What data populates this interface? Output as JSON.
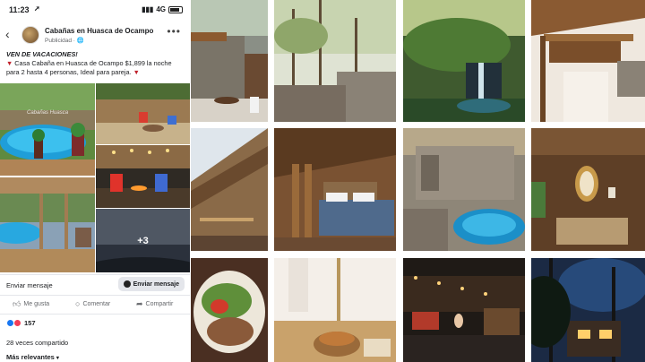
{
  "status_bar": {
    "time": "11:23",
    "network": "4G"
  },
  "post": {
    "page_name": "Cabañas en Huasca de Ocampo",
    "sponsored": "Publicidad · 🌐",
    "headline": "VEN DE VACACIONES!",
    "body_before": "Casa Cabaña en Huasca de Ocampo $1,899 la noche para 2 hasta 4 personas, Ideal para pareja.",
    "photo_overflow": "+3",
    "watermark": "Cabañas Huasca"
  },
  "message": {
    "label": "Enviar mensaje",
    "button": "Enviar mensaje"
  },
  "actions": {
    "like": "Me gusta",
    "comment": "Comentar",
    "share": "Compartir"
  },
  "stats": {
    "reactions": "157",
    "shares": "28 veces compartido",
    "sort": "Más relevantes"
  },
  "icons": {
    "back": "chevron-left-icon",
    "more": "more-dots-icon",
    "like": "thumbs-up-icon",
    "comment": "comment-bubble-icon",
    "share": "share-arrow-icon",
    "messenger": "messenger-icon"
  },
  "colors": {
    "facebook_blue": "#1877f2",
    "love_red": "#f33e58",
    "pin_red": "#c0202a"
  }
}
